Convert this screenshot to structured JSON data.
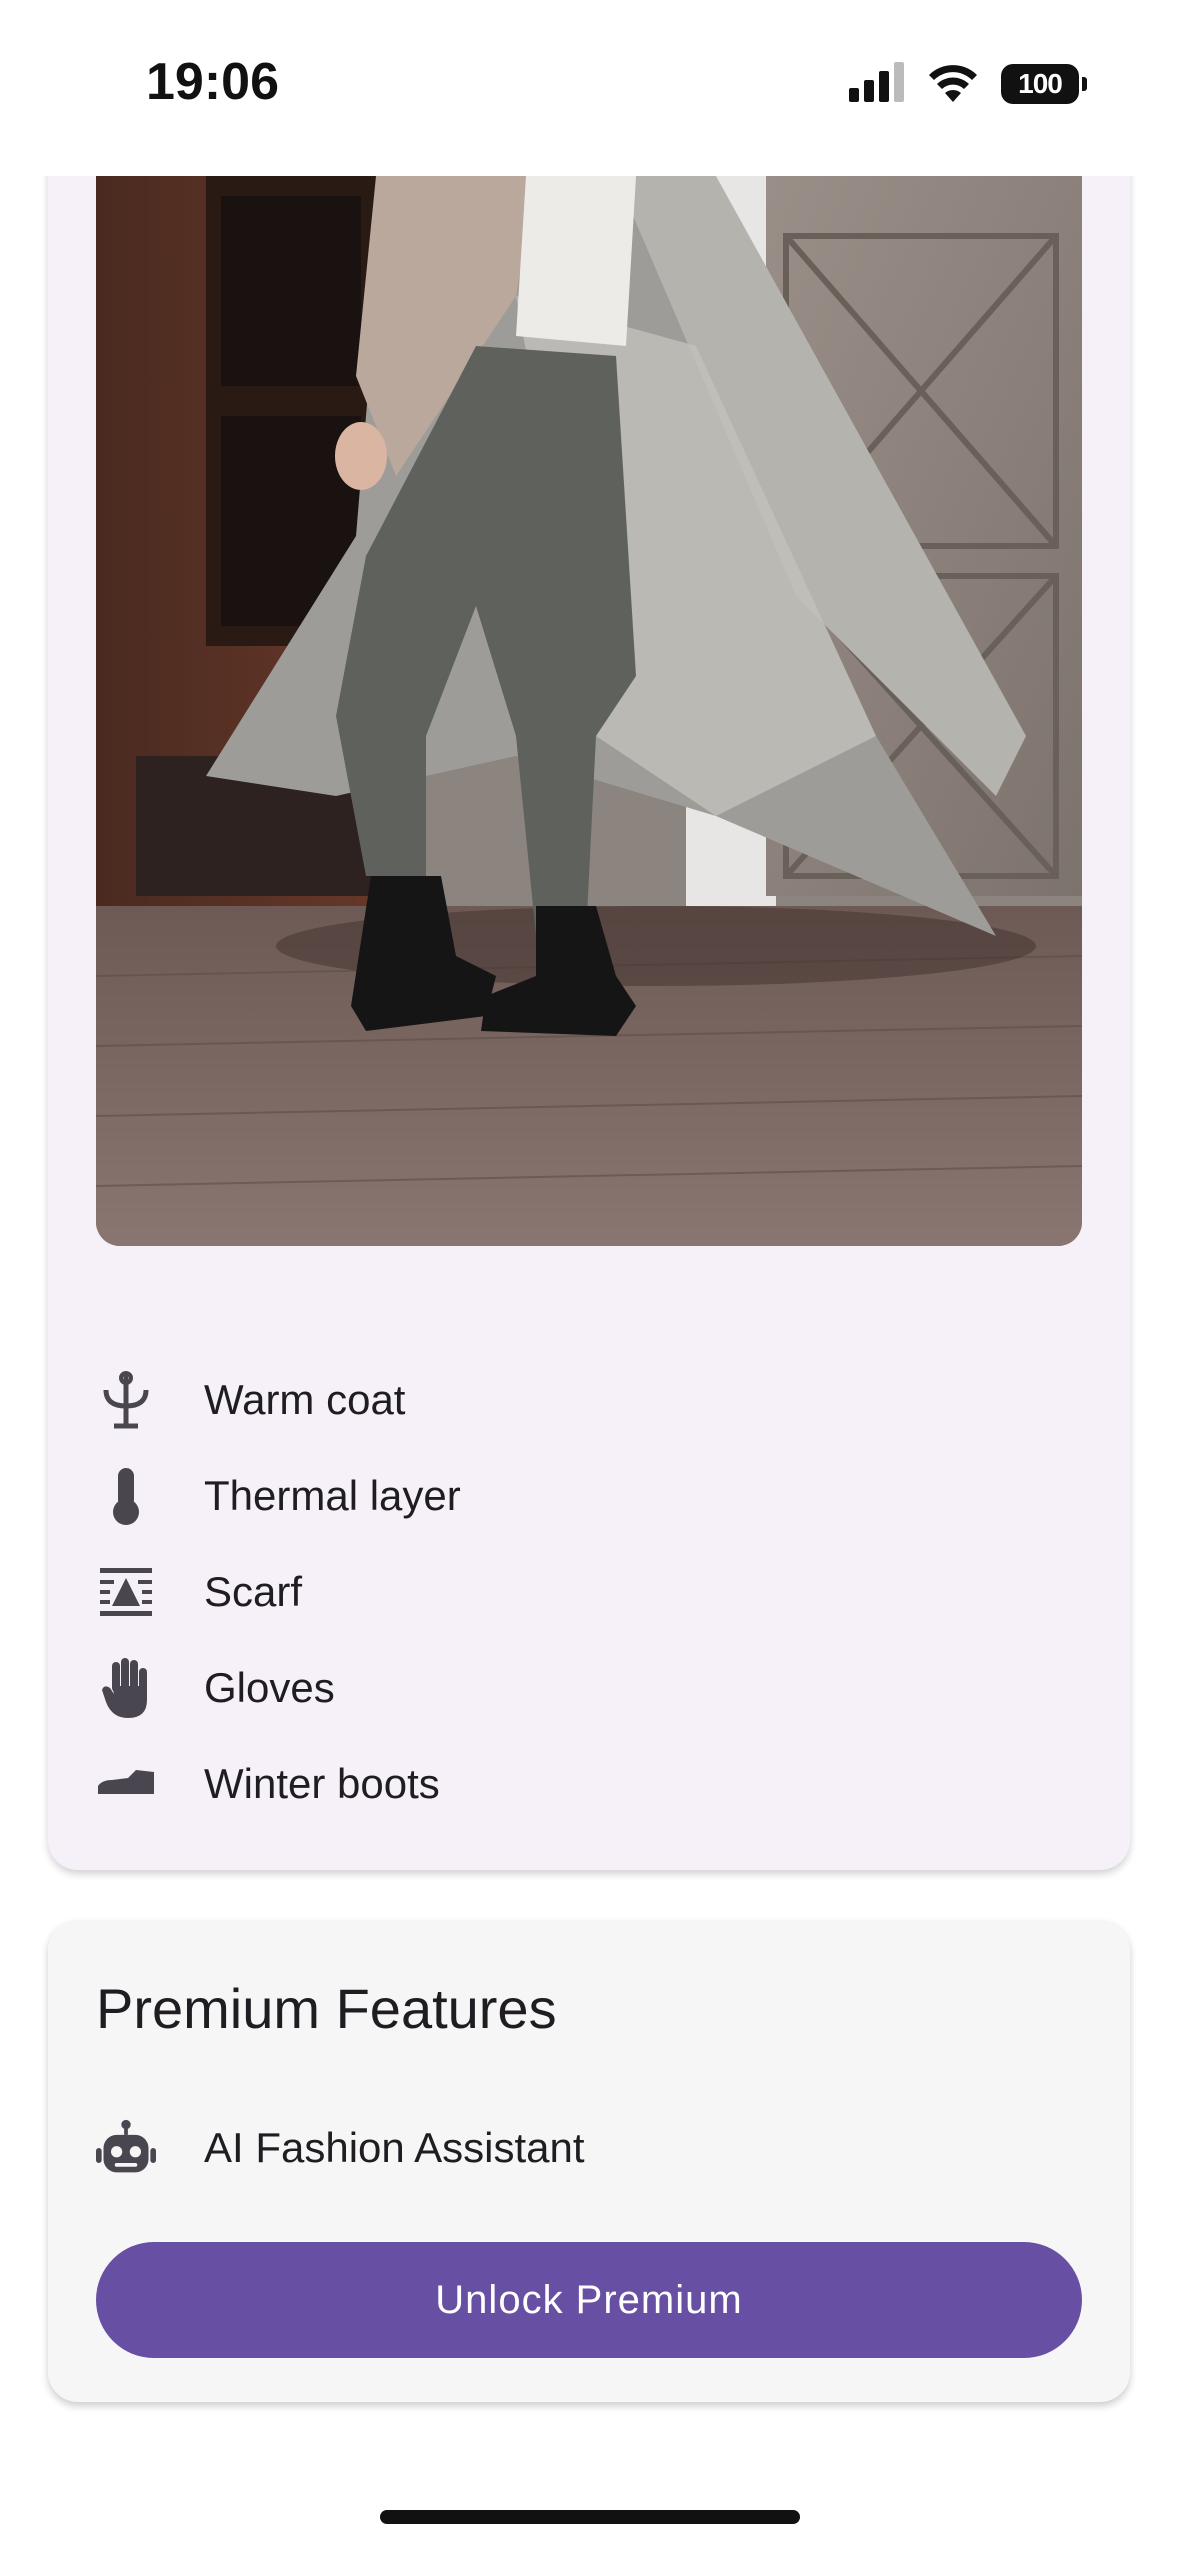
{
  "status_bar": {
    "time": "19:06",
    "battery": "100"
  },
  "outfit": {
    "photo_alt": "person in grey coat, grey jeans and black boots",
    "items": [
      {
        "label": "Warm coat",
        "icon": "coat-hanger-icon"
      },
      {
        "label": "Thermal layer",
        "icon": "thermometer-icon"
      },
      {
        "label": "Scarf",
        "icon": "scarf-icon"
      },
      {
        "label": "Gloves",
        "icon": "hand-icon"
      },
      {
        "label": "Winter boots",
        "icon": "boot-icon"
      }
    ]
  },
  "premium": {
    "title": "Premium Features",
    "feature_label": "AI Fashion Assistant",
    "feature_icon": "robot-icon",
    "button_label": "Unlock Premium"
  },
  "colors": {
    "accent": "#6750a4",
    "card_background": "#f6f1f8",
    "premium_card_background": "#f7f6f7",
    "icon": "#4a4650"
  }
}
